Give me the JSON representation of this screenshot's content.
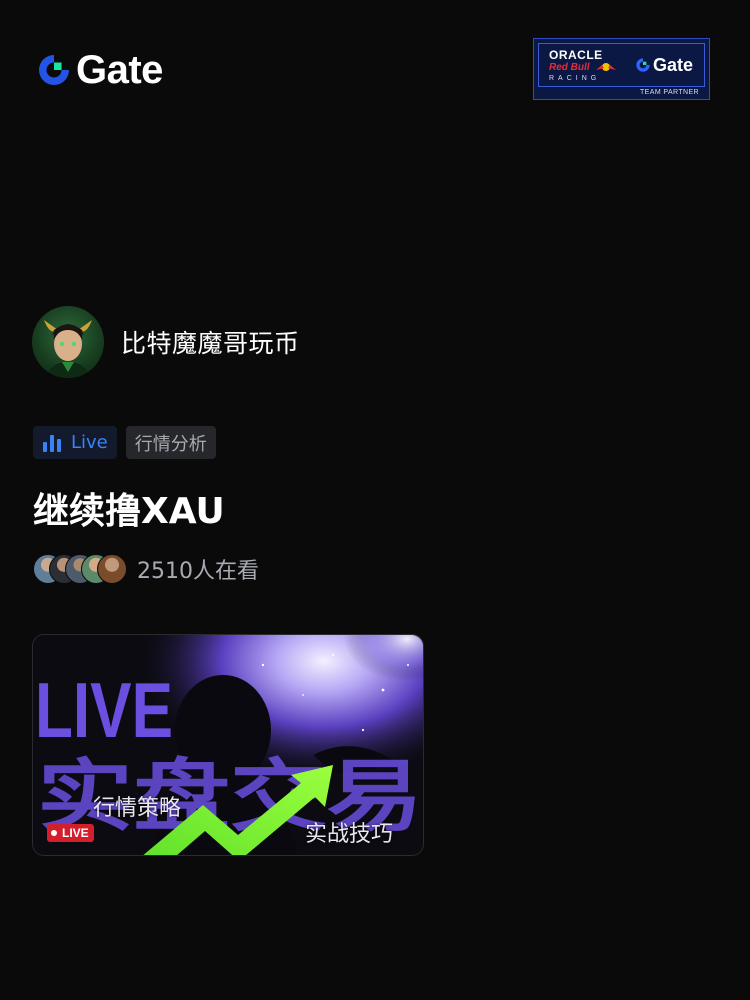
{
  "brand": {
    "logo_text": "Gate",
    "logo_icon": "gate-logo-icon",
    "primary_color": "#2354e6",
    "accent_color": "#17e5a0"
  },
  "partner_badge": {
    "oracle": "ORACLE",
    "redbull": "Red Bull",
    "racing": "RACING",
    "gate": "Gate",
    "team_partner": "TEAM PARTNER"
  },
  "streamer": {
    "name": "比特魔魔哥玩币",
    "avatar_icon": "streamer-avatar"
  },
  "tags": {
    "live_label": "Live",
    "live_icon": "bar-chart-icon",
    "live_color": "#3b82f6",
    "topic_label": "行情分析"
  },
  "stream": {
    "title": "继续撸XAU",
    "viewer_count_text": "2510人在看"
  },
  "cover": {
    "headline_en": "LIVE",
    "headline_cn": "实盘交易",
    "caption_left": "行情策略",
    "caption_right": "实战技巧",
    "live_chip": "LIVE",
    "headline_color": "#6b4fe0",
    "arrow_color": "#7dff2f"
  }
}
